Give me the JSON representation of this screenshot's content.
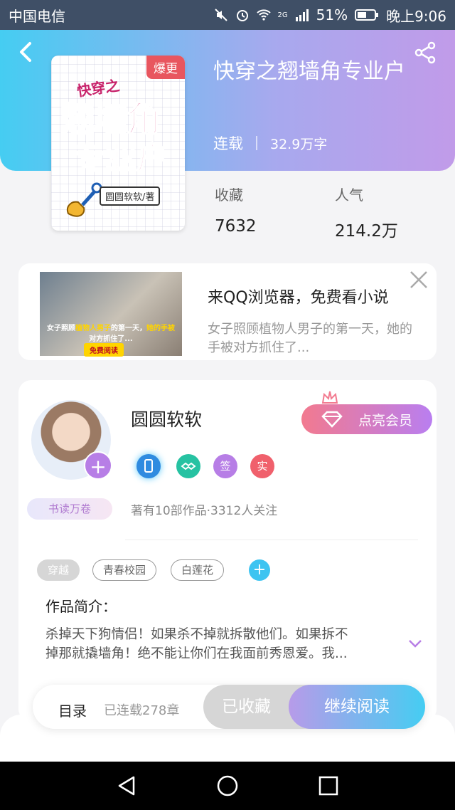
{
  "status_bar": {
    "carrier": "中国电信",
    "network": "2G",
    "battery": "51%",
    "time": "晚上9:06"
  },
  "book": {
    "badge": "爆更",
    "title": "快穿之翘墙角专业户",
    "status": "连载",
    "word_count": "32.9万字",
    "cover_text_1": "快穿之",
    "cover_text_2": "翘墙角",
    "cover_text_3": "专业户",
    "cover_author": "圆圆软软/著"
  },
  "stats": {
    "favorites_label": "收藏",
    "favorites_value": "7632",
    "popularity_label": "人气",
    "popularity_value": "214.2万"
  },
  "ad": {
    "title": "来QQ浏览器，免费看小说",
    "description": "女子照顾植物人男子的第一天，她的\n手被对方抓住了...",
    "image_caption_1": "女子照顾",
    "image_caption_hl": "植物人男子",
    "image_caption_2": "的第一天，",
    "image_caption_hl2": "她的手被",
    "image_caption_3": "对方抓住了...",
    "image_button": "免费阅读"
  },
  "author": {
    "name": "圆圆软软",
    "reader_badge": "书读万卷",
    "vip_button": "点亮会员",
    "badge_sign": "签",
    "badge_real": "实",
    "follow_info": "著有10部作品·3312人关注"
  },
  "tags": [
    "穿越",
    "青春校园",
    "白莲花"
  ],
  "intro": {
    "title": "作品简介：",
    "text": "杀掉天下狗情侣！如果杀不掉就拆散他们。如果拆不\n掉那就撬墙角！绝不能让你们在我面前秀恩爱。我..."
  },
  "bottom": {
    "toc": "目录",
    "chapters": "已连载278章",
    "saved": "已收藏",
    "read": "继续阅读"
  },
  "colors": {
    "header_start": "#45cdf2",
    "header_end": "#c19be9",
    "accent_purple": "#b77ee6",
    "badge_red": "#e8565f"
  },
  "icons": {
    "back": "back-arrow-icon",
    "share": "share-icon",
    "close": "close-icon",
    "expand": "chevron-down-icon"
  }
}
